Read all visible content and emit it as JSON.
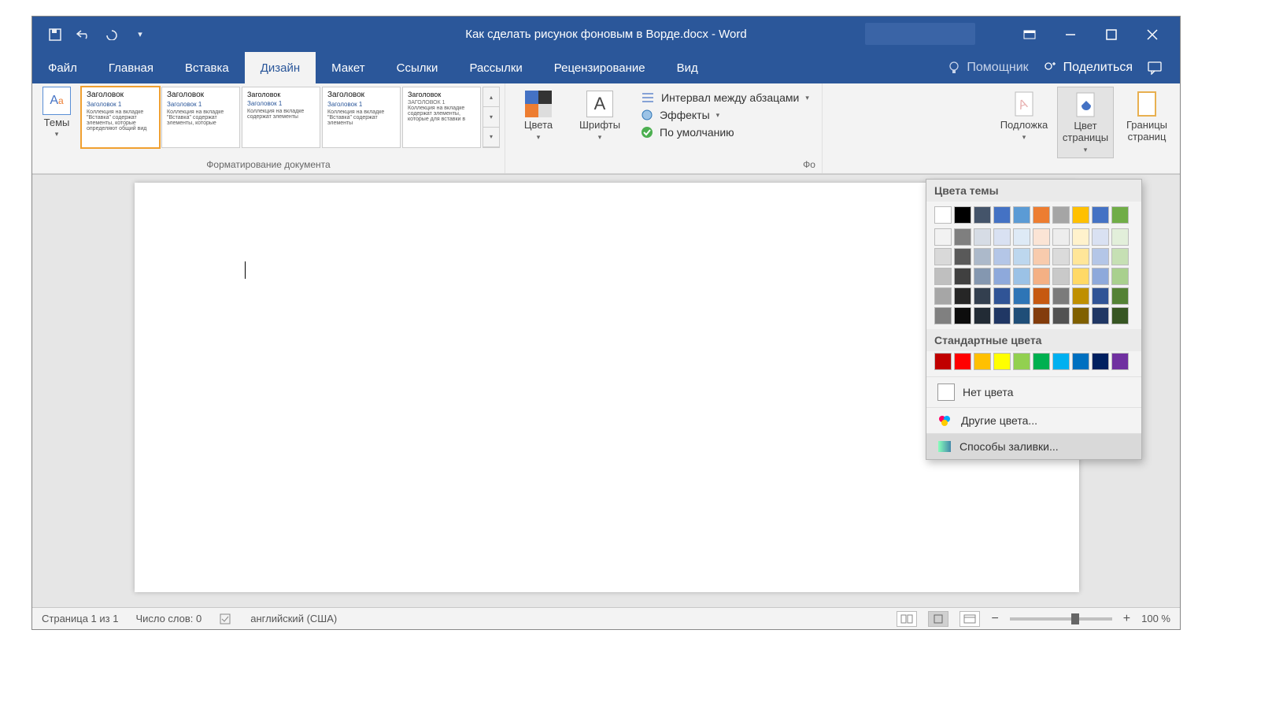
{
  "title": "Как сделать рисунок фоновым в Ворде.docx  -  Word",
  "tabs": [
    "Файл",
    "Главная",
    "Вставка",
    "Дизайн",
    "Макет",
    "Ссылки",
    "Рассылки",
    "Рецензирование",
    "Вид"
  ],
  "active_tab_index": 3,
  "tell_me": "Помощник",
  "share": "Поделиться",
  "ribbon": {
    "themes": "Темы",
    "gallery_heading": "Заголовок",
    "gallery_sub": "Заголовок 1",
    "doc_format_caption": "Форматирование документа",
    "colors": "Цвета",
    "fonts": "Шрифты",
    "spacing": "Интервал между абзацами",
    "effects": "Эффекты",
    "default": "По умолчанию",
    "watermark": "Подложка",
    "page_color": "Цвет страницы",
    "borders": "Границы страниц",
    "bg_caption": "Фо"
  },
  "popup": {
    "theme_title": "Цвета темы",
    "std_title": "Стандартные цвета",
    "no_color": "Нет цвета",
    "more_colors": "Другие цвета...",
    "fill_effects": "Способы заливки...",
    "theme_row": [
      "#ffffff",
      "#000000",
      "#44546a",
      "#4472c4",
      "#5b9bd5",
      "#ed7d31",
      "#a5a5a5",
      "#ffc000",
      "#4472c4",
      "#70ad47"
    ],
    "theme_shades": [
      [
        "#f2f2f2",
        "#7f7f7f",
        "#d6dce5",
        "#d9e1f2",
        "#deeaf6",
        "#fbe4d5",
        "#ededed",
        "#fff2cc",
        "#d9e1f2",
        "#e2efda"
      ],
      [
        "#d9d9d9",
        "#595959",
        "#acb9ca",
        "#b4c6e7",
        "#bdd7ee",
        "#f8cbad",
        "#dbdbdb",
        "#ffe699",
        "#b4c6e7",
        "#c6e0b4"
      ],
      [
        "#bfbfbf",
        "#404040",
        "#8497b0",
        "#8ea9db",
        "#9bc2e6",
        "#f4b084",
        "#c9c9c9",
        "#ffd966",
        "#8ea9db",
        "#a9d08e"
      ],
      [
        "#a6a6a6",
        "#262626",
        "#333f4f",
        "#305496",
        "#2e75b6",
        "#c65911",
        "#7b7b7b",
        "#bf8f00",
        "#305496",
        "#548235"
      ],
      [
        "#808080",
        "#0d0d0d",
        "#222b35",
        "#203764",
        "#1f4e78",
        "#833c0c",
        "#525252",
        "#806000",
        "#203764",
        "#375623"
      ]
    ],
    "standard": [
      "#c00000",
      "#ff0000",
      "#ffc000",
      "#ffff00",
      "#92d050",
      "#00b050",
      "#00b0f0",
      "#0070c0",
      "#002060",
      "#7030a0"
    ]
  },
  "status": {
    "page": "Страница 1 из 1",
    "words": "Число слов: 0",
    "lang": "английский (США)",
    "zoom": "100 %"
  }
}
